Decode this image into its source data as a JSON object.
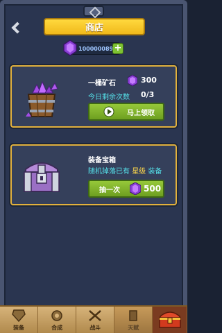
{
  "header": {
    "title": "商店",
    "back_icon": "chevron-left-icon"
  },
  "currency": {
    "amount": "1000000899",
    "gem_icon": "purple-gem-icon",
    "add_label": "+"
  },
  "offers": [
    {
      "name": "一桶矿石",
      "cost": "300",
      "remaining_label": "今日剩余次数",
      "remaining_value": "0/3",
      "button_label": "马上领取",
      "icon": "ore-bucket-icon"
    },
    {
      "name": "装备宝箱",
      "desc_prefix": "随机掉落已有",
      "desc_highlight": "星级",
      "desc_suffix": "装备",
      "button_label": "抽一次",
      "cost": "500",
      "icon": "equipment-chest-icon"
    }
  ],
  "nav": [
    {
      "label": "装备",
      "icon": "equipment-icon"
    },
    {
      "label": "合成",
      "icon": "merge-icon"
    },
    {
      "label": "战斗",
      "icon": "battle-icon"
    },
    {
      "label": "天赋",
      "icon": "talent-icon"
    },
    {
      "label": "",
      "icon": "shop-chest-icon"
    }
  ],
  "colors": {
    "accent_gold": "#e2b13c",
    "gem_purple": "#9b4de0",
    "button_green": "#7fb22c",
    "info_cyan": "#55e0e8"
  }
}
